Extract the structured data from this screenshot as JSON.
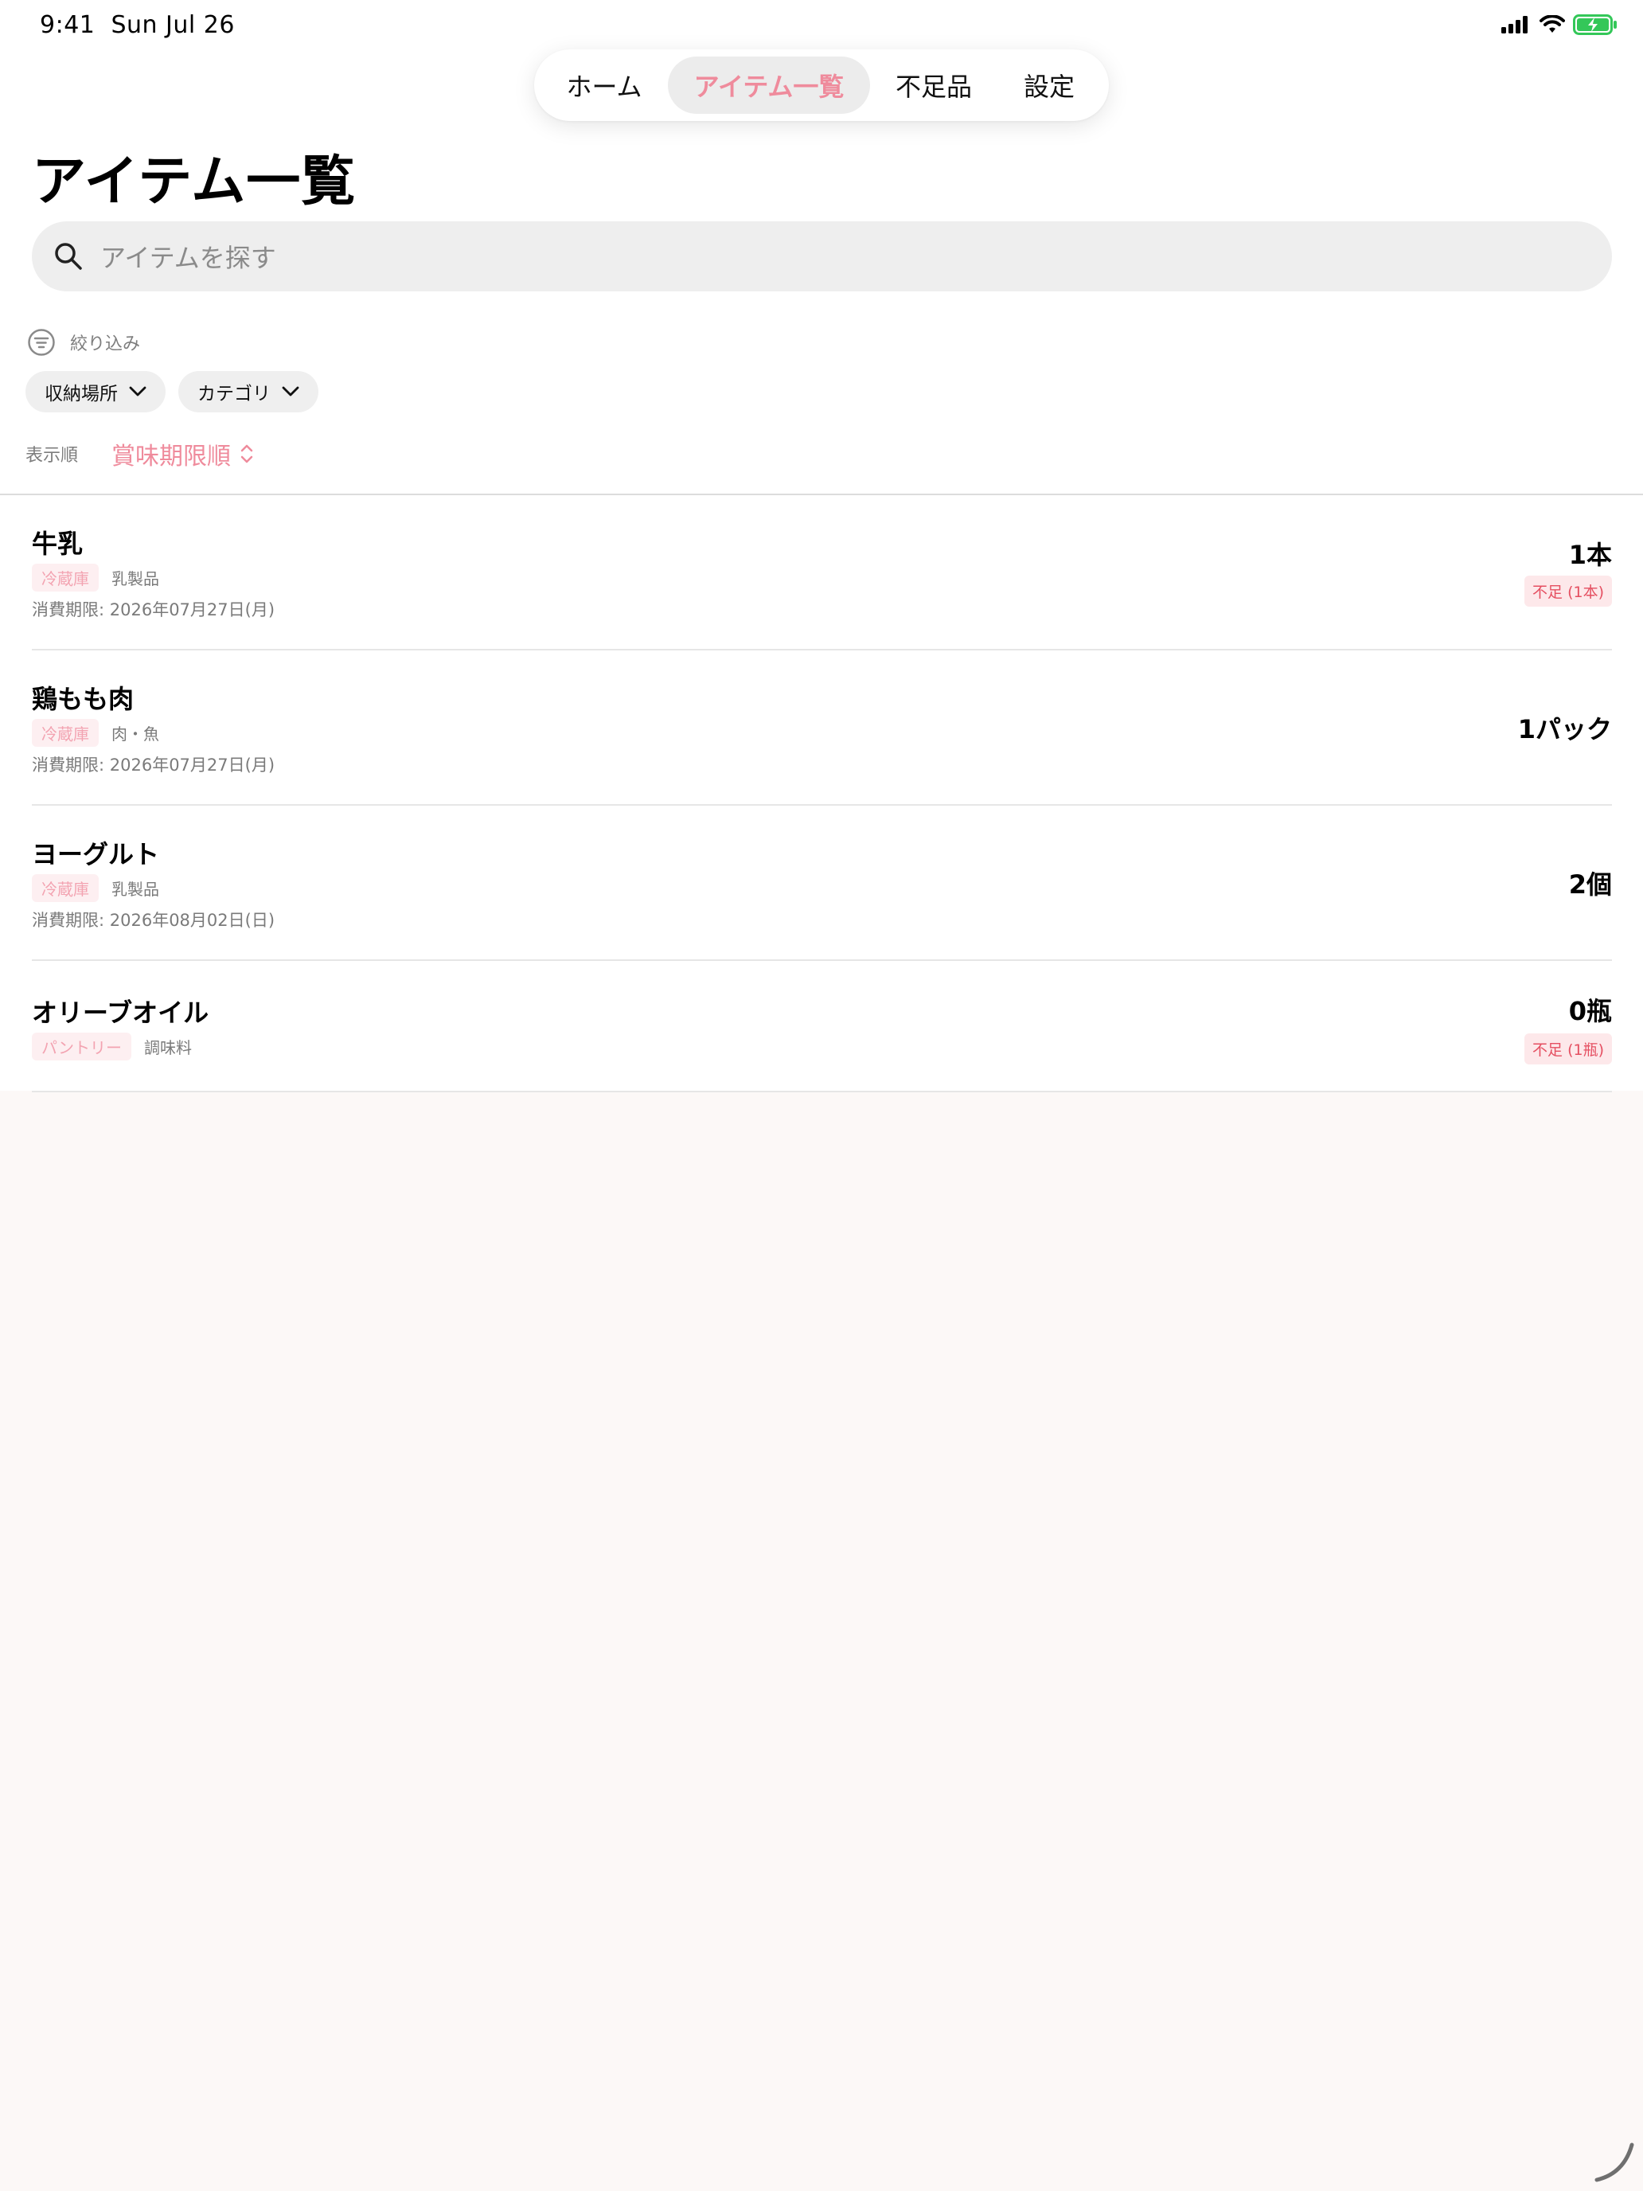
{
  "status_bar": {
    "time": "9:41",
    "date": "Sun Jul 26"
  },
  "tabs": [
    {
      "label": "ホーム"
    },
    {
      "label": "アイテム一覧"
    },
    {
      "label": "不足品"
    },
    {
      "label": "設定"
    }
  ],
  "active_tab": "アイテム一覧",
  "page_title": "アイテム一覧",
  "search": {
    "placeholder": "アイテムを探す"
  },
  "filter": {
    "label": "絞り込み",
    "chips": [
      "収納場所",
      "カテゴリ"
    ]
  },
  "sort": {
    "label": "表示順",
    "value": "賞味期限順"
  },
  "items": [
    {
      "name": "牛乳",
      "location": "冷蔵庫",
      "category": "乳製品",
      "expiry": "消費期限: 2026年07月27日(月)",
      "quantity": "1本",
      "shortage": "不足 (1本)"
    },
    {
      "name": "鶏もも肉",
      "location": "冷蔵庫",
      "category": "肉・魚",
      "expiry": "消費期限: 2026年07月27日(月)",
      "quantity": "1パック"
    },
    {
      "name": "ヨーグルト",
      "location": "冷蔵庫",
      "category": "乳製品",
      "expiry": "消費期限: 2026年08月02日(日)",
      "quantity": "2個"
    },
    {
      "name": "オリーブオイル",
      "location": "パントリー",
      "category": "調味料",
      "quantity": "0瓶",
      "shortage": "不足 (1瓶)"
    }
  ],
  "colors": {
    "accent_pink": "#ef8b9c",
    "shortage_red": "#e54f61",
    "background": "#fcf8f7",
    "battery_green": "#34c759"
  }
}
